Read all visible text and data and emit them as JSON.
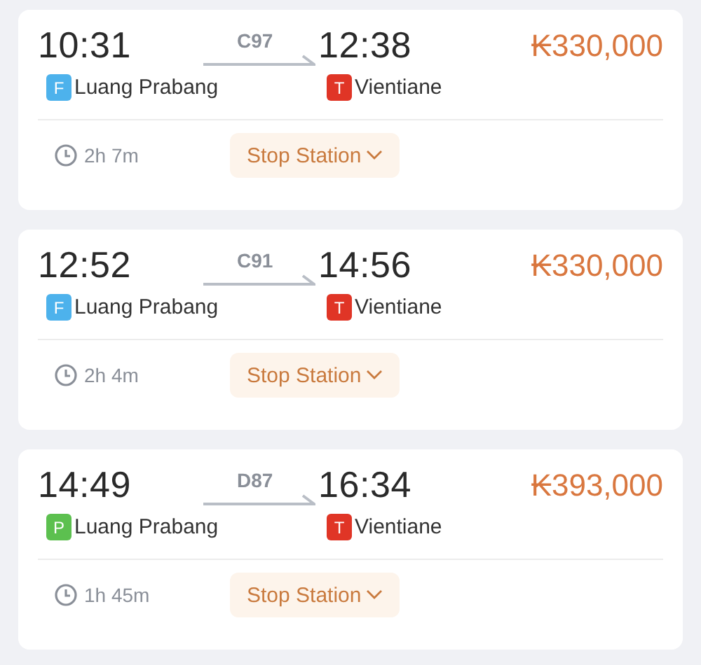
{
  "trips": [
    {
      "depart_time": "10:31",
      "train": "C97",
      "arrive_time": "12:38",
      "price": "₭330,000",
      "from": {
        "badge": "F",
        "color": "#4db2ec",
        "name": "Luang Prabang"
      },
      "to": {
        "badge": "T",
        "color": "#e03526",
        "name": "Vientiane"
      },
      "duration": "2h 7m",
      "stops_button": "Stop Station"
    },
    {
      "depart_time": "12:52",
      "train": "C91",
      "arrive_time": "14:56",
      "price": "₭330,000",
      "from": {
        "badge": "F",
        "color": "#4db2ec",
        "name": "Luang Prabang"
      },
      "to": {
        "badge": "T",
        "color": "#e03526",
        "name": "Vientiane"
      },
      "duration": "2h 4m",
      "stops_button": "Stop Station"
    },
    {
      "depart_time": "14:49",
      "train": "D87",
      "arrive_time": "16:34",
      "price": "₭393,000",
      "from": {
        "badge": "P",
        "color": "#5cc04f",
        "name": "Luang Prabang"
      },
      "to": {
        "badge": "T",
        "color": "#e03526",
        "name": "Vientiane"
      },
      "duration": "1h 45m",
      "stops_button": "Stop Station"
    }
  ]
}
